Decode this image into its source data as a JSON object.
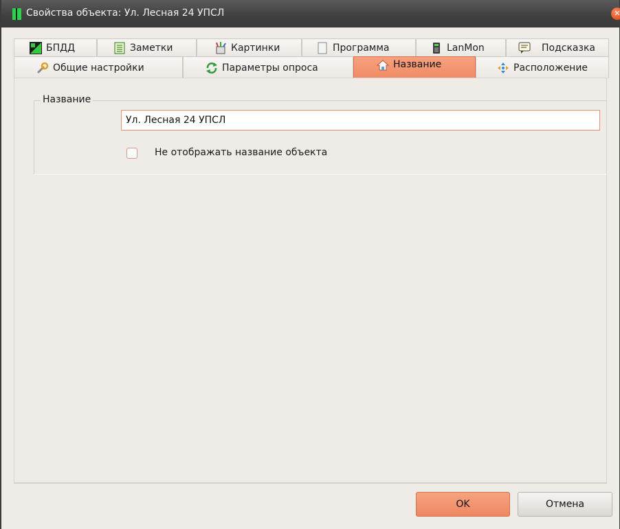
{
  "window": {
    "title": "Свойства объекта: Ул. Лесная 24 УПСЛ",
    "close_glyph": "✕"
  },
  "tabs_row1": [
    {
      "label": "БПДД",
      "icon": "bpdd-icon"
    },
    {
      "label": "Заметки",
      "icon": "notes-icon"
    },
    {
      "label": "Картинки",
      "icon": "pictures-icon"
    },
    {
      "label": "Программа",
      "icon": "program-icon"
    },
    {
      "label": "LanMon",
      "icon": "lanmon-icon"
    },
    {
      "label": "Подсказка",
      "icon": "hint-icon"
    }
  ],
  "tabs_row2": [
    {
      "label": "Общие настройки",
      "icon": "wrench-icon"
    },
    {
      "label": "Параметры опроса",
      "icon": "refresh-icon"
    },
    {
      "label": "Название",
      "icon": "home-icon",
      "active": true
    },
    {
      "label": "Расположение",
      "icon": "move-arrows-icon"
    }
  ],
  "content": {
    "group_label": "Название",
    "name_value": "Ул. Лесная 24 УПСЛ",
    "hide_name_label": "Не отображать название объекта",
    "hide_name_checked": false
  },
  "buttons": {
    "ok": "OK",
    "cancel": "Отмена"
  },
  "colors": {
    "accent": "#ef8b66",
    "titlebar": "#444444",
    "background": "#efebe7"
  }
}
